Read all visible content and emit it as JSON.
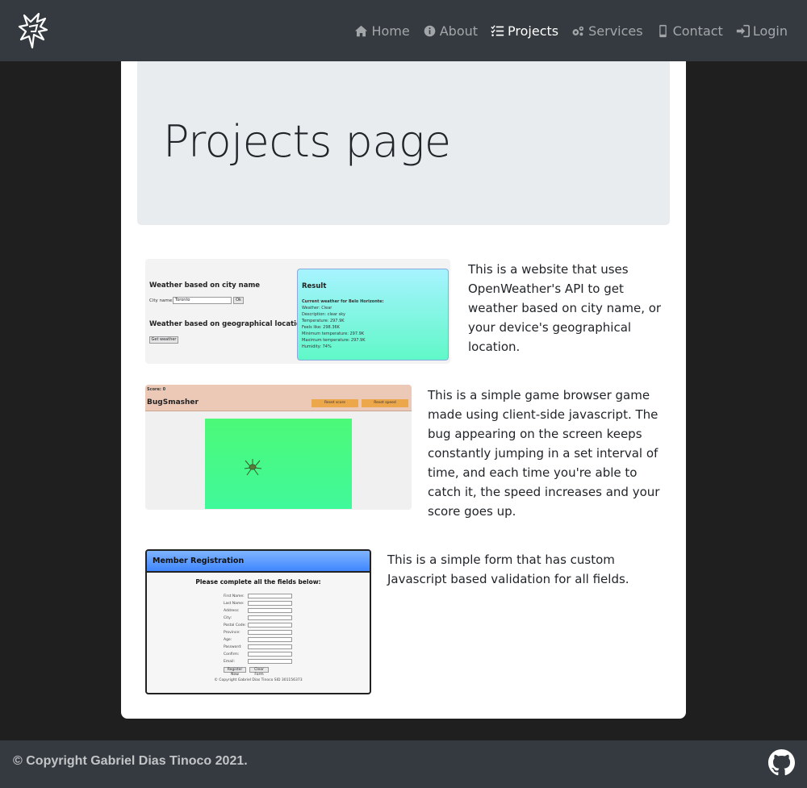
{
  "nav": {
    "items": [
      {
        "label": "Home",
        "icon": "home-icon"
      },
      {
        "label": "About",
        "icon": "info-circle-icon"
      },
      {
        "label": "Projects",
        "icon": "tasks-icon",
        "active": true
      },
      {
        "label": "Services",
        "icon": "cogs-icon"
      },
      {
        "label": "Contact",
        "icon": "mobile-icon"
      },
      {
        "label": "Login",
        "icon": "sign-in-icon"
      }
    ]
  },
  "page": {
    "title": "Projects page"
  },
  "projects": [
    {
      "description": "This is a website that uses OpenWeather's API to get weather based on city name, or your device's geographical location.",
      "thumb": {
        "heading1": "Weather based on city name",
        "city_label": "City name:",
        "city_value": "Toronto",
        "ok": "Ok",
        "heading2": "Weather based on geographical location",
        "get_weather": "Get weather",
        "result_title": "Result",
        "result_lines": [
          "Current weather for Belo Horizonte:",
          "Weather: Clear",
          "Description: clear sky",
          "Temperature: 297.9K",
          "Feels like: 298.36K",
          "Minimum temperature: 297.9K",
          "Maximum temperature: 297.9K",
          "Humidity: 74%"
        ]
      }
    },
    {
      "description": "This is a simple game browser game made using client-side javascript. The bug appearing on the screen keeps constantly jumping in a set interval of time, and each time you're able to catch it, the speed increases and your score goes up.",
      "thumb": {
        "score": "Score: 0",
        "title": "BugSmasher",
        "reset_score": "Reset score",
        "reset_speed": "Reset speed"
      }
    },
    {
      "description": "This is a simple form that has custom Javascript based validation for all fields.",
      "thumb": {
        "header": "Member Registration",
        "subtitle": "Please complete all the fields below:",
        "fields": [
          "First Name:",
          "Last Name:",
          "Address:",
          "City:",
          "Postal Code:",
          "Province:",
          "Age:",
          "Password:",
          "Confirm:",
          "Email:"
        ],
        "register": "Register Now",
        "clear": "Clear Form",
        "copyright": "© Copyright Gabriel Dias Tinoco SID 301156373"
      }
    }
  ],
  "footer": {
    "copyright": "© Copyright Gabriel Dias Tinoco 2021.",
    "icon": "github-icon"
  }
}
